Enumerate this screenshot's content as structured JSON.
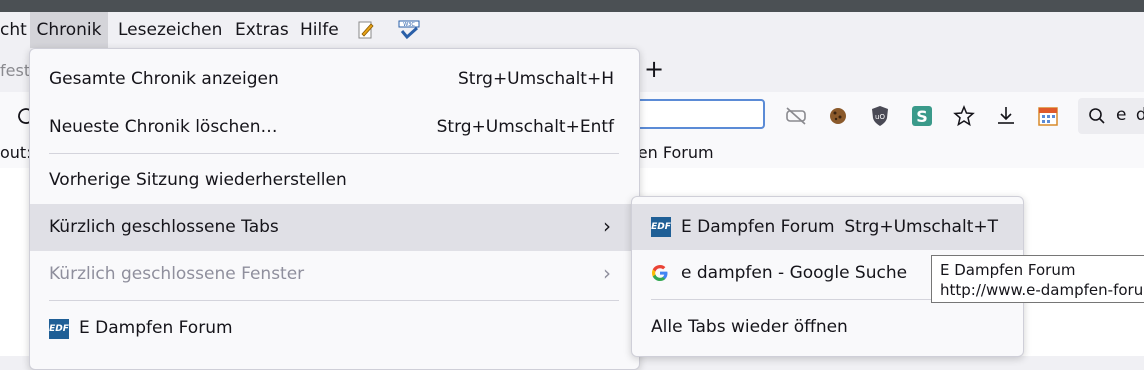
{
  "menubar": {
    "items": [
      "cht",
      "Chronik",
      "Lesezeichen",
      "Extras",
      "Hilfe"
    ],
    "icons": [
      "notepad-icon",
      "w3c-validator-icon"
    ]
  },
  "tabs": {
    "partial_tab_text": "fest",
    "new_tab_symbol": "+"
  },
  "navbar": {
    "search_value": "e d"
  },
  "bookmarks": {
    "partial_left": "out:c",
    "partial_right": "pfen Forum"
  },
  "chronik_menu": {
    "items": [
      {
        "label": "Gesamte Chronik anzeigen",
        "shortcut": "Strg+Umschalt+H"
      },
      {
        "label": "Neueste Chronik löschen…",
        "shortcut": "Strg+Umschalt+Entf"
      },
      {
        "label": "Vorherige Sitzung wiederherstellen"
      },
      {
        "label": "Kürzlich geschlossene Tabs",
        "submenu": true,
        "state": "highlighted"
      },
      {
        "label": "Kürzlich geschlossene Fenster",
        "submenu": true,
        "state": "disabled"
      },
      {
        "label": "E Dampfen Forum",
        "icon": "edf-favicon"
      }
    ]
  },
  "closed_tabs_submenu": {
    "items": [
      {
        "label": "E Dampfen Forum",
        "shortcut": "Strg+Umschalt+T",
        "icon": "edf-favicon",
        "state": "highlighted"
      },
      {
        "label": "e dampfen - Google Suche",
        "icon": "google-favicon"
      },
      {
        "label": "Alle Tabs wieder öffnen"
      }
    ]
  },
  "tooltip": {
    "title": "E Dampfen Forum",
    "url": "http://www.e-dampfen-forum"
  },
  "colors": {
    "highlight": "#e0e0e6",
    "menu_bg": "#f9f9fb",
    "edf_blue": "#1f5f96",
    "url_focus": "#5b8bd6"
  }
}
